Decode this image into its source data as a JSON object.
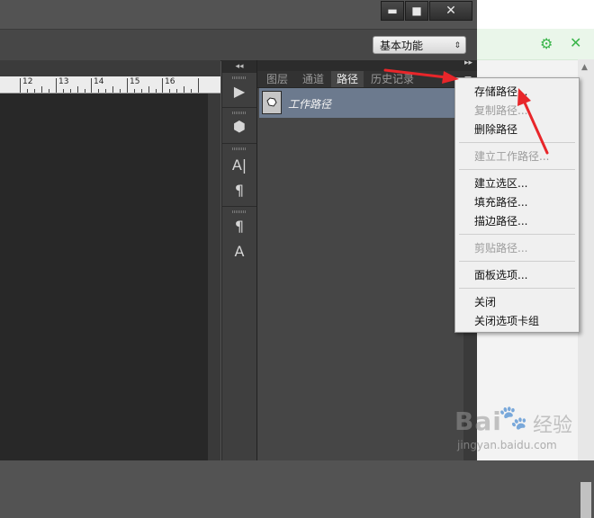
{
  "window": {
    "min_label": "▬",
    "max_label": "■",
    "close_label": "✕"
  },
  "options_bar": {
    "workspace_value": "基本功能",
    "workspace_arrow": "⇕"
  },
  "ruler": {
    "labels": [
      "12",
      "13",
      "14",
      "15",
      "16"
    ]
  },
  "dock": {
    "header_label": "◂◂",
    "icons": [
      "play-icon",
      "3d-icon",
      "character-icon",
      "paragraph-icon",
      "paragraph-styles-icon",
      "character-styles-icon"
    ],
    "icon_glyphs": [
      "▶",
      "⬢",
      "A|",
      "¶",
      "¶",
      "A"
    ]
  },
  "panel": {
    "collapse_label": "▸▸",
    "tabs": [
      {
        "label": "图层"
      },
      {
        "label": "通道"
      },
      {
        "label": "路径"
      },
      {
        "label": "历史记录"
      }
    ],
    "active_tab": "路径",
    "menu_button": "≡",
    "path_row_name": "工作路径"
  },
  "context_menu": {
    "items": [
      {
        "label": "存储路径...",
        "enabled": true
      },
      {
        "label": "复制路径...",
        "enabled": false
      },
      {
        "label": "删除路径",
        "enabled": true
      },
      {
        "label": "建立工作路径...",
        "enabled": false
      },
      {
        "label": "建立选区...",
        "enabled": true
      },
      {
        "label": "填充路径...",
        "enabled": true
      },
      {
        "label": "描边路径...",
        "enabled": true
      },
      {
        "label": "剪贴路径...",
        "enabled": false
      },
      {
        "label": "面板选项...",
        "enabled": true
      },
      {
        "label": "关闭",
        "enabled": true
      },
      {
        "label": "关闭选项卡组",
        "enabled": true
      }
    ]
  },
  "browser": {
    "gear_glyph": "⚙",
    "close_glyph": "✕",
    "scroll_up_glyph": "▲"
  },
  "watermark": {
    "logo_text": "Bai",
    "paw_glyph": "🐾",
    "cn_text": "经验",
    "url_text": "jingyan.baidu.com"
  },
  "colors": {
    "annotation_arrow": "#e8262a",
    "selected_path_row": "#6c7a8e",
    "browser_accent": "#3ab54a"
  }
}
